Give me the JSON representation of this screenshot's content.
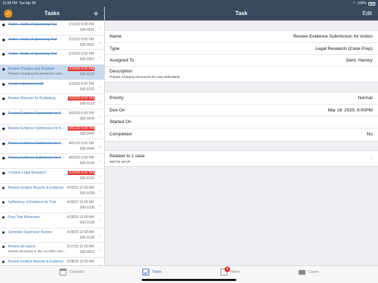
{
  "status_bar": {
    "time": "11:58 PM",
    "date": "Tue Apr 28",
    "battery": "100%"
  },
  "left_nav": {
    "title": "Tasks",
    "add_label": "+"
  },
  "right_nav": {
    "title": "Task",
    "edit_label": "Edit"
  },
  "tasks": [
    {
      "title": "Victim - Notify of Upcoming Trial",
      "date": "3/12/20 5:00 PM",
      "code": "S00-0031",
      "strike": true,
      "overdue": false,
      "bullet": "diamond",
      "selected": false,
      "subtitle": ""
    },
    {
      "title": "Victim - Notify of Upcoming Trial",
      "date": "3/13/20 5:00 PM",
      "code": "S00-0031",
      "strike": true,
      "overdue": false,
      "bullet": "diamond",
      "selected": false,
      "subtitle": ""
    },
    {
      "title": "Victim - Notify of Upcoming Trial",
      "date": "3/15/20 5:00 PM",
      "code": "S00-0007",
      "strike": true,
      "overdue": false,
      "bullet": "diamond",
      "selected": false,
      "subtitle": ""
    },
    {
      "title": "Review Charges and Dictation",
      "date": "3/18/20 6:00 PM",
      "code": "S00-0132",
      "strike": false,
      "overdue": true,
      "bullet": "diamond",
      "selected": true,
      "subtitle": "Prepare Charging Documents for case d..."
    },
    {
      "title": "Create Indictment Draft",
      "date": "3/23/20 6:00 PM",
      "code": "S00-0132",
      "strike": true,
      "overdue": false,
      "bullet": "diamond",
      "selected": false,
      "subtitle": ""
    },
    {
      "title": "Review Discover for Publishing",
      "date": "3/23/20 6:00 PM",
      "code": "S00-0132",
      "strike": false,
      "overdue": true,
      "bullet": "diamond",
      "selected": false,
      "subtitle": ""
    },
    {
      "title": "Review Evidence Submission for Action",
      "date": "4/01/20 5:00 PM",
      "code": "S00-0049",
      "strike": true,
      "overdue": false,
      "bullet": "diamond",
      "selected": false,
      "subtitle": ""
    },
    {
      "title": "Review Evidence Submission for Action",
      "date": "4/01/20 6:00 PM",
      "code": "S00-0049",
      "strike": false,
      "overdue": true,
      "bullet": "diamond",
      "selected": false,
      "subtitle": ""
    },
    {
      "title": "Review Evidence Submission for Action",
      "date": "4/01/20 5:00 PM",
      "code": "S00-0049",
      "strike": true,
      "overdue": false,
      "bullet": "diamond",
      "selected": false,
      "subtitle": ""
    },
    {
      "title": "Review Evidence Submission for Action",
      "date": "4/02/20 5:00 PM",
      "code": "S00-0138",
      "strike": true,
      "overdue": false,
      "bullet": "diamond",
      "selected": false,
      "subtitle": ""
    },
    {
      "title": "Conduct Legal Research",
      "date": "4/24/20 6:00 PM",
      "code": "S00-0132",
      "strike": false,
      "overdue": true,
      "bullet": "diamond",
      "selected": false,
      "subtitle": ""
    },
    {
      "title": "Review Incident Reports & Evidence",
      "date": "4/29/20 12:00 AM",
      "code": "S00-0138",
      "strike": false,
      "overdue": false,
      "bullet": "square",
      "selected": false,
      "subtitle": ""
    },
    {
      "title": "Sufficiency of Evidence for Trial",
      "date": "4/29/20 12:00 AM",
      "code": "S00-0138",
      "strike": false,
      "overdue": false,
      "bullet": "square",
      "selected": false,
      "subtitle": ""
    },
    {
      "title": "Prep Trial Witnesses",
      "date": "4/29/20 12:00 AM",
      "code": "S00-0138",
      "strike": false,
      "overdue": false,
      "bullet": "square",
      "selected": false,
      "subtitle": ""
    },
    {
      "title": "Schedule Supervisor Review",
      "date": "4/29/20 12:00 AM",
      "code": "S00-0138",
      "strike": false,
      "overdue": false,
      "bullet": "square",
      "selected": false,
      "subtitle": ""
    },
    {
      "title": "Review all reports",
      "date": "5/17/20 12:00 AM",
      "code": "S00-0013",
      "strike": false,
      "overdue": false,
      "bullet": "square",
      "selected": false,
      "subtitle": "Review all reports in JM, run RMS report..."
    },
    {
      "title": "Review Incident Reports & Evidence",
      "date": "5/28/20 12:00 AM",
      "code": "",
      "strike": false,
      "overdue": false,
      "bullet": "square",
      "selected": false,
      "subtitle": ""
    }
  ],
  "detail": {
    "name": {
      "label": "Name",
      "value": "Review Evidence Submission for Action"
    },
    "type": {
      "label": "Type",
      "value": "Legal Research (Case Prep)"
    },
    "assigned_to": {
      "label": "Assigned To",
      "value": "Dent, Harvey"
    },
    "description": {
      "label": "Description",
      "value": "Prepare Charging Documents for case defendants"
    },
    "priority": {
      "label": "Priority",
      "value": "Normal"
    },
    "due_on": {
      "label": "Due On",
      "value": "Mar 18, 2020, 6:00PM"
    },
    "started_on": {
      "label": "Started On",
      "value": ""
    },
    "completed": {
      "label": "Completed",
      "value": "No"
    },
    "related": {
      "label": "Related to 1 case",
      "value": "564732-18-CR"
    }
  },
  "tab_bar": {
    "calendar": "Calendar",
    "tasks": "Tasks",
    "notes": "Notes",
    "notes_badge": "4",
    "cases": "Cases"
  },
  "colors": {
    "nav_bg": "#3a4a5e",
    "accent": "#2f74c0",
    "overdue": "#e6322b",
    "selected_row": "#c9daef",
    "badge": "#e8951f"
  }
}
